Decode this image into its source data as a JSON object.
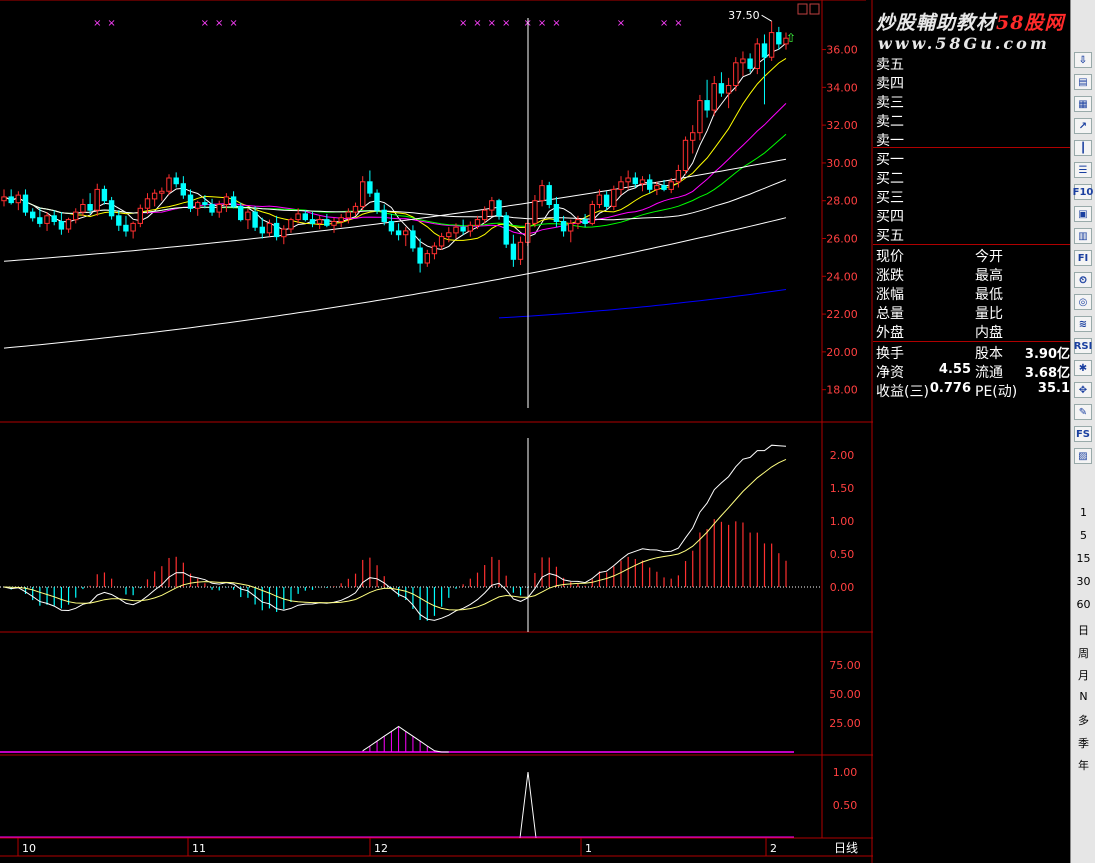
{
  "watermark": {
    "line1_a": "炒股輔助教材",
    "line1_b": "58股网",
    "line2": "www.58Gu.com"
  },
  "quote_panel": {
    "ask_labels": [
      "卖五",
      "卖四",
      "卖三",
      "卖二",
      "卖一"
    ],
    "bid_labels": [
      "买一",
      "买二",
      "买三",
      "买四",
      "买五"
    ],
    "stats_left": [
      "现价",
      "涨跌",
      "涨幅",
      "总量",
      "外盘"
    ],
    "stats_right": [
      "今开",
      "最高",
      "最低",
      "量比",
      "内盘"
    ],
    "fin": [
      {
        "l1": "换手",
        "v1": "",
        "l2": "股本",
        "v2": "3.90亿"
      },
      {
        "l1": "净资",
        "v1": "4.55",
        "l2": "流通",
        "v2": "3.68亿"
      },
      {
        "l1": "收益(三)",
        "v1": "0.776",
        "l2": "PE(动)",
        "v2": "35.1"
      }
    ]
  },
  "price_chart": {
    "ylim": [
      16.5,
      38.2
    ],
    "yticks": [
      "36.00",
      "34.00",
      "32.00",
      "30.00",
      "28.00",
      "26.00",
      "24.00",
      "22.00",
      "20.00",
      "18.00"
    ],
    "high_label": "37.50",
    "bear_color": "#00ffff",
    "bull_color": "#ff3030",
    "candles": [
      [
        28.0,
        28.6,
        27.7,
        28.2
      ],
      [
        28.2,
        28.6,
        27.8,
        27.9
      ],
      [
        27.9,
        28.5,
        27.5,
        28.3
      ],
      [
        28.3,
        28.6,
        27.2,
        27.4
      ],
      [
        27.4,
        27.6,
        26.9,
        27.1
      ],
      [
        27.1,
        27.6,
        26.6,
        26.8
      ],
      [
        26.8,
        27.4,
        26.4,
        27.2
      ],
      [
        27.2,
        27.5,
        26.7,
        26.9
      ],
      [
        26.9,
        27.4,
        26.2,
        26.5
      ],
      [
        26.5,
        27.1,
        26.3,
        27.0
      ],
      [
        27.0,
        27.6,
        26.8,
        27.4
      ],
      [
        27.4,
        28.1,
        27.2,
        27.8
      ],
      [
        27.8,
        28.4,
        27.3,
        27.5
      ],
      [
        27.5,
        28.9,
        27.2,
        28.6
      ],
      [
        28.6,
        28.8,
        27.8,
        28.0
      ],
      [
        28.0,
        28.2,
        27.0,
        27.2
      ],
      [
        27.2,
        27.5,
        26.4,
        26.7
      ],
      [
        26.7,
        27.2,
        26.1,
        26.4
      ],
      [
        26.4,
        26.9,
        26.0,
        26.8
      ],
      [
        26.8,
        27.8,
        26.6,
        27.6
      ],
      [
        27.6,
        28.4,
        27.3,
        28.1
      ],
      [
        28.1,
        28.6,
        27.7,
        28.4
      ],
      [
        28.4,
        28.7,
        28.0,
        28.5
      ],
      [
        28.5,
        29.4,
        28.3,
        29.2
      ],
      [
        29.2,
        29.5,
        28.7,
        28.9
      ],
      [
        28.9,
        29.3,
        28.1,
        28.3
      ],
      [
        28.3,
        28.6,
        27.4,
        27.6
      ],
      [
        27.6,
        28.0,
        27.2,
        27.9
      ],
      [
        27.9,
        28.3,
        27.6,
        27.8
      ],
      [
        27.8,
        28.1,
        27.2,
        27.4
      ],
      [
        27.4,
        28.0,
        27.1,
        27.8
      ],
      [
        27.8,
        28.4,
        27.4,
        28.2
      ],
      [
        28.2,
        28.5,
        27.6,
        27.7
      ],
      [
        27.7,
        27.9,
        26.9,
        27.0
      ],
      [
        27.0,
        27.6,
        26.5,
        27.4
      ],
      [
        27.4,
        27.7,
        26.4,
        26.6
      ],
      [
        26.6,
        27.1,
        26.0,
        26.3
      ],
      [
        26.3,
        27.0,
        26.1,
        26.8
      ],
      [
        26.8,
        27.2,
        25.9,
        26.1
      ],
      [
        26.1,
        26.7,
        25.7,
        26.5
      ],
      [
        26.5,
        27.1,
        26.3,
        27.0
      ],
      [
        27.0,
        27.6,
        26.8,
        27.3
      ],
      [
        27.3,
        27.5,
        26.9,
        27.0
      ],
      [
        27.0,
        27.4,
        26.6,
        26.8
      ],
      [
        26.8,
        27.2,
        26.5,
        27.0
      ],
      [
        27.0,
        27.3,
        26.6,
        26.7
      ],
      [
        26.7,
        27.1,
        26.3,
        26.9
      ],
      [
        26.9,
        27.3,
        26.6,
        27.1
      ],
      [
        27.1,
        27.6,
        26.8,
        27.4
      ],
      [
        27.4,
        27.9,
        27.2,
        27.7
      ],
      [
        27.7,
        29.3,
        27.5,
        29.0
      ],
      [
        29.0,
        29.6,
        28.2,
        28.4
      ],
      [
        28.4,
        28.6,
        27.3,
        27.5
      ],
      [
        27.5,
        27.8,
        26.7,
        26.9
      ],
      [
        26.9,
        27.3,
        26.2,
        26.4
      ],
      [
        26.4,
        26.8,
        25.9,
        26.2
      ],
      [
        26.2,
        26.6,
        25.6,
        26.4
      ],
      [
        26.4,
        26.7,
        25.3,
        25.5
      ],
      [
        25.5,
        26.0,
        24.2,
        24.7
      ],
      [
        24.7,
        25.4,
        24.5,
        25.2
      ],
      [
        25.2,
        25.8,
        24.9,
        25.6
      ],
      [
        25.6,
        26.3,
        25.4,
        26.1
      ],
      [
        26.1,
        26.6,
        25.8,
        26.3
      ],
      [
        26.3,
        26.8,
        26.0,
        26.6
      ],
      [
        26.6,
        27.0,
        26.2,
        26.4
      ],
      [
        26.4,
        26.9,
        26.1,
        26.7
      ],
      [
        26.7,
        27.2,
        26.5,
        27.0
      ],
      [
        27.0,
        27.7,
        26.8,
        27.5
      ],
      [
        27.5,
        28.2,
        27.2,
        28.0
      ],
      [
        28.0,
        28.1,
        27.0,
        27.2
      ],
      [
        27.2,
        27.4,
        25.5,
        25.7
      ],
      [
        25.7,
        26.2,
        24.5,
        24.9
      ],
      [
        24.9,
        26.1,
        24.6,
        25.8
      ],
      [
        25.8,
        27.0,
        25.6,
        26.8
      ],
      [
        26.8,
        28.3,
        26.6,
        28.0
      ],
      [
        28.0,
        29.1,
        27.7,
        28.8
      ],
      [
        28.8,
        29.0,
        27.6,
        27.8
      ],
      [
        27.8,
        28.2,
        26.6,
        26.9
      ],
      [
        26.9,
        27.2,
        26.1,
        26.4
      ],
      [
        26.4,
        27.0,
        25.8,
        26.8
      ],
      [
        26.8,
        27.2,
        26.5,
        27.0
      ],
      [
        27.0,
        27.3,
        26.6,
        26.8
      ],
      [
        26.8,
        28.0,
        26.7,
        27.8
      ],
      [
        27.8,
        28.6,
        27.6,
        28.3
      ],
      [
        28.3,
        28.5,
        27.5,
        27.7
      ],
      [
        27.7,
        28.8,
        27.5,
        28.6
      ],
      [
        28.6,
        29.3,
        28.3,
        29.0
      ],
      [
        29.0,
        29.6,
        28.6,
        29.2
      ],
      [
        29.2,
        29.5,
        28.7,
        28.9
      ],
      [
        28.9,
        29.3,
        28.5,
        29.1
      ],
      [
        29.1,
        29.4,
        28.4,
        28.6
      ],
      [
        28.6,
        29.0,
        28.3,
        28.8
      ],
      [
        28.8,
        29.1,
        28.5,
        28.6
      ],
      [
        28.6,
        29.2,
        28.4,
        29.0
      ],
      [
        29.0,
        29.9,
        28.7,
        29.6
      ],
      [
        29.6,
        31.4,
        29.4,
        31.2
      ],
      [
        31.2,
        32.0,
        30.5,
        31.6
      ],
      [
        31.6,
        33.6,
        31.2,
        33.3
      ],
      [
        33.3,
        34.4,
        32.4,
        32.8
      ],
      [
        32.8,
        34.6,
        32.5,
        34.2
      ],
      [
        34.2,
        34.8,
        33.5,
        33.7
      ],
      [
        33.7,
        34.5,
        32.9,
        34.1
      ],
      [
        34.1,
        35.6,
        33.8,
        35.3
      ],
      [
        35.3,
        35.9,
        34.6,
        35.5
      ],
      [
        35.5,
        35.8,
        34.8,
        35.0
      ],
      [
        35.0,
        36.6,
        34.7,
        36.3
      ],
      [
        36.3,
        36.8,
        33.1,
        35.6
      ],
      [
        35.6,
        37.5,
        35.4,
        36.9
      ],
      [
        36.9,
        37.2,
        36.0,
        36.3
      ],
      [
        36.3,
        36.9,
        36.0,
        36.6
      ]
    ],
    "ma_colors": [
      "#ffffff",
      "#ffff00",
      "#ff00ff",
      "#00ff00",
      "#ffffff",
      "#ffffff",
      "#ffffff",
      "#0000ff"
    ]
  },
  "macd": {
    "yticks": [
      "2.00",
      "1.50",
      "1.00",
      "0.50",
      "0.00"
    ],
    "pos_color": "#ff3030",
    "neg_color": "#00ffff"
  },
  "ind3": {
    "yticks": [
      "75.00",
      "50.00",
      "25.00"
    ],
    "color": "#ff00ff"
  },
  "ind4": {
    "yticks": [
      "1.00",
      "0.50"
    ]
  },
  "x_axis": {
    "labels": [
      "10",
      "11",
      "12",
      "1",
      "2"
    ]
  },
  "period_label": "日线",
  "toolbar": {
    "icons": [
      "down-arrow-icon",
      "doc-icon",
      "grid-icon",
      "line-chart-icon",
      "candle-icon",
      "list-icon",
      "f10-icon",
      "info-icon",
      "fund-icon",
      "fiz-icon",
      "clock-icon",
      "circle-icon",
      "wave-icon",
      "rsi-icon",
      "tools-icon",
      "move-icon",
      "pencil-icon",
      "fs-icon",
      "image-icon"
    ],
    "icon_glyphs": [
      "⇩",
      "▤",
      "▦",
      "↗",
      "┃",
      "☰",
      "F10",
      "▣",
      "▥",
      "FI",
      "⏲",
      "◎",
      "≋",
      "RSI",
      "✱",
      "✥",
      "✎",
      "FS",
      "▨"
    ],
    "periods": [
      "1",
      "5",
      "15",
      "30",
      "60",
      "日",
      "周",
      "月",
      "N",
      "多",
      "季",
      "年"
    ]
  }
}
